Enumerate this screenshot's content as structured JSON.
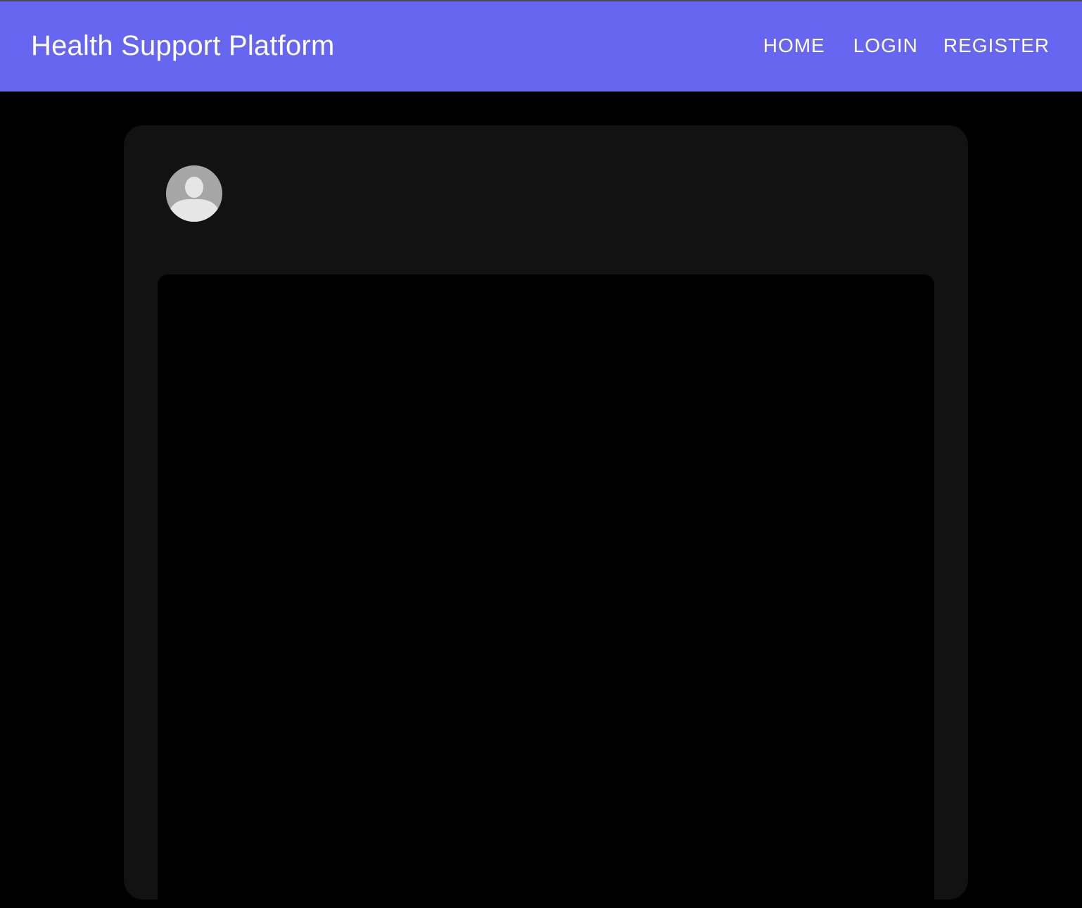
{
  "header": {
    "title": "Health Support Platform",
    "nav": [
      {
        "label": "HOME"
      },
      {
        "label": "LOGIN"
      },
      {
        "label": "REGISTER"
      }
    ]
  },
  "profile": {
    "avatar_icon": "user-avatar-icon"
  },
  "colors": {
    "appbar": "#6666F1",
    "page_background": "#000000",
    "card_background": "#121212",
    "avatar_background": "#a6a6a6",
    "avatar_figure": "#e6e6e6"
  }
}
